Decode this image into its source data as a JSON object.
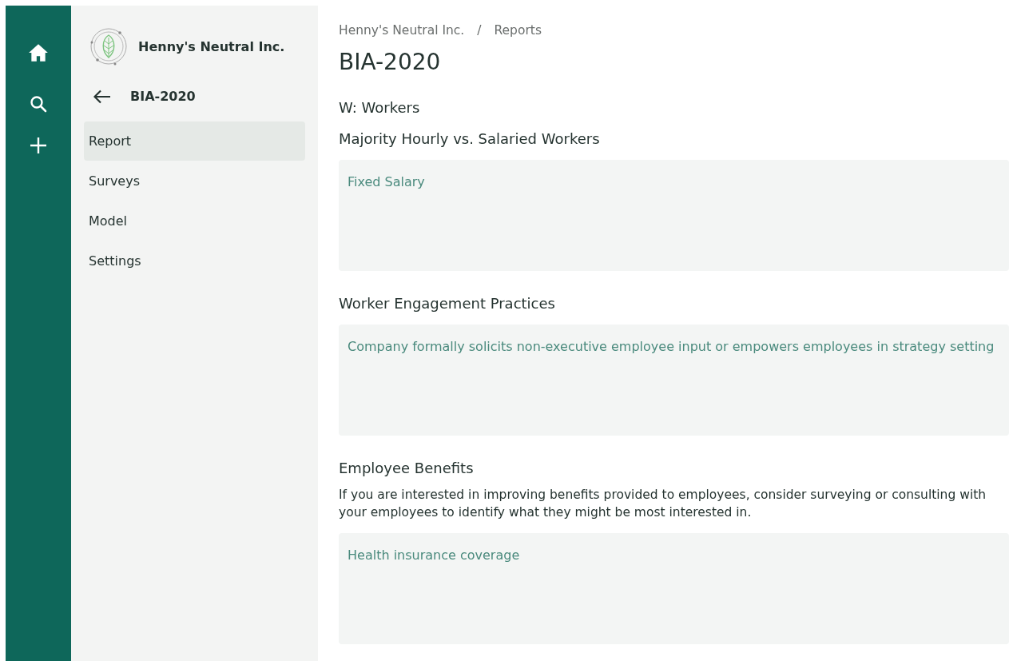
{
  "rail": {
    "items": [
      {
        "kind": "home"
      },
      {
        "kind": "search"
      },
      {
        "kind": "add"
      }
    ]
  },
  "sidebar": {
    "org_name": "Henny's Neutral Inc.",
    "back_title": "BIA-2020",
    "items": [
      {
        "label": "Report",
        "selected": true
      },
      {
        "label": "Surveys",
        "selected": false
      },
      {
        "label": "Model",
        "selected": false
      },
      {
        "label": "Settings",
        "selected": false
      }
    ]
  },
  "breadcrumb": [
    "Henny's Neutral Inc.",
    "Reports"
  ],
  "breadcrumb_separator": "/",
  "title": "BIA-2020",
  "section": "W: Workers",
  "questions": [
    {
      "label": "Majority Hourly vs. Salaried Workers",
      "value": "Fixed Salary"
    },
    {
      "label": "Worker Engagement Practices",
      "value": "Company formally solicits non-executive employee input or empowers employees in strategy setting"
    },
    {
      "label": "Employee Benefits",
      "hint": "If you are interested in improving benefits provided to employees, consider surveying or consulting with your employees to identify what they might be most interested in.",
      "value": "Health insurance coverage"
    }
  ]
}
